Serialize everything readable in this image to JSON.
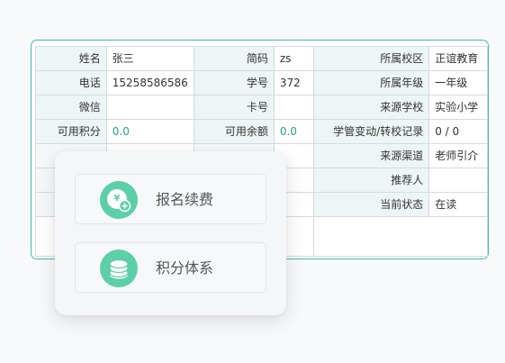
{
  "student": {
    "row1": {
      "name_label": "姓名",
      "name_value": "张三",
      "abbr_label": "简码",
      "abbr_value": "zs",
      "campus_label": "所属校区",
      "campus_value": "正谊教育"
    },
    "row2": {
      "phone_label": "电话",
      "phone_value": "15258586586",
      "id_label": "学号",
      "id_value": "372",
      "grade_label": "所属年级",
      "grade_value": "一年级"
    },
    "row3": {
      "wechat_label": "微信",
      "wechat_value": "",
      "card_label": "卡号",
      "card_value": "",
      "school_label": "来源学校",
      "school_value": "实验小学"
    },
    "row4": {
      "points_label": "可用积分",
      "points_value": "0.0",
      "balance_label": "可用余额",
      "balance_value": "0.0",
      "transfer_label": "学管变动/转校记录",
      "transfer_value": "0 / 0"
    },
    "row5": {
      "channel_label": "来源渠道",
      "channel_value": "老师引介"
    },
    "row6": {
      "referrer_label": "推荐人",
      "referrer_value": ""
    },
    "row7": {
      "status_label": "当前状态",
      "status_value": "在读"
    }
  },
  "popup_menu": {
    "items": [
      {
        "label": "报名续费",
        "icon": "yen-coin-plus-icon"
      },
      {
        "label": "积分体系",
        "icon": "coin-stack-icon"
      }
    ]
  },
  "colors": {
    "accent": "#3bbfa6",
    "icon_bg": "#5dcfa8",
    "value_highlight": "#2aa58c"
  }
}
